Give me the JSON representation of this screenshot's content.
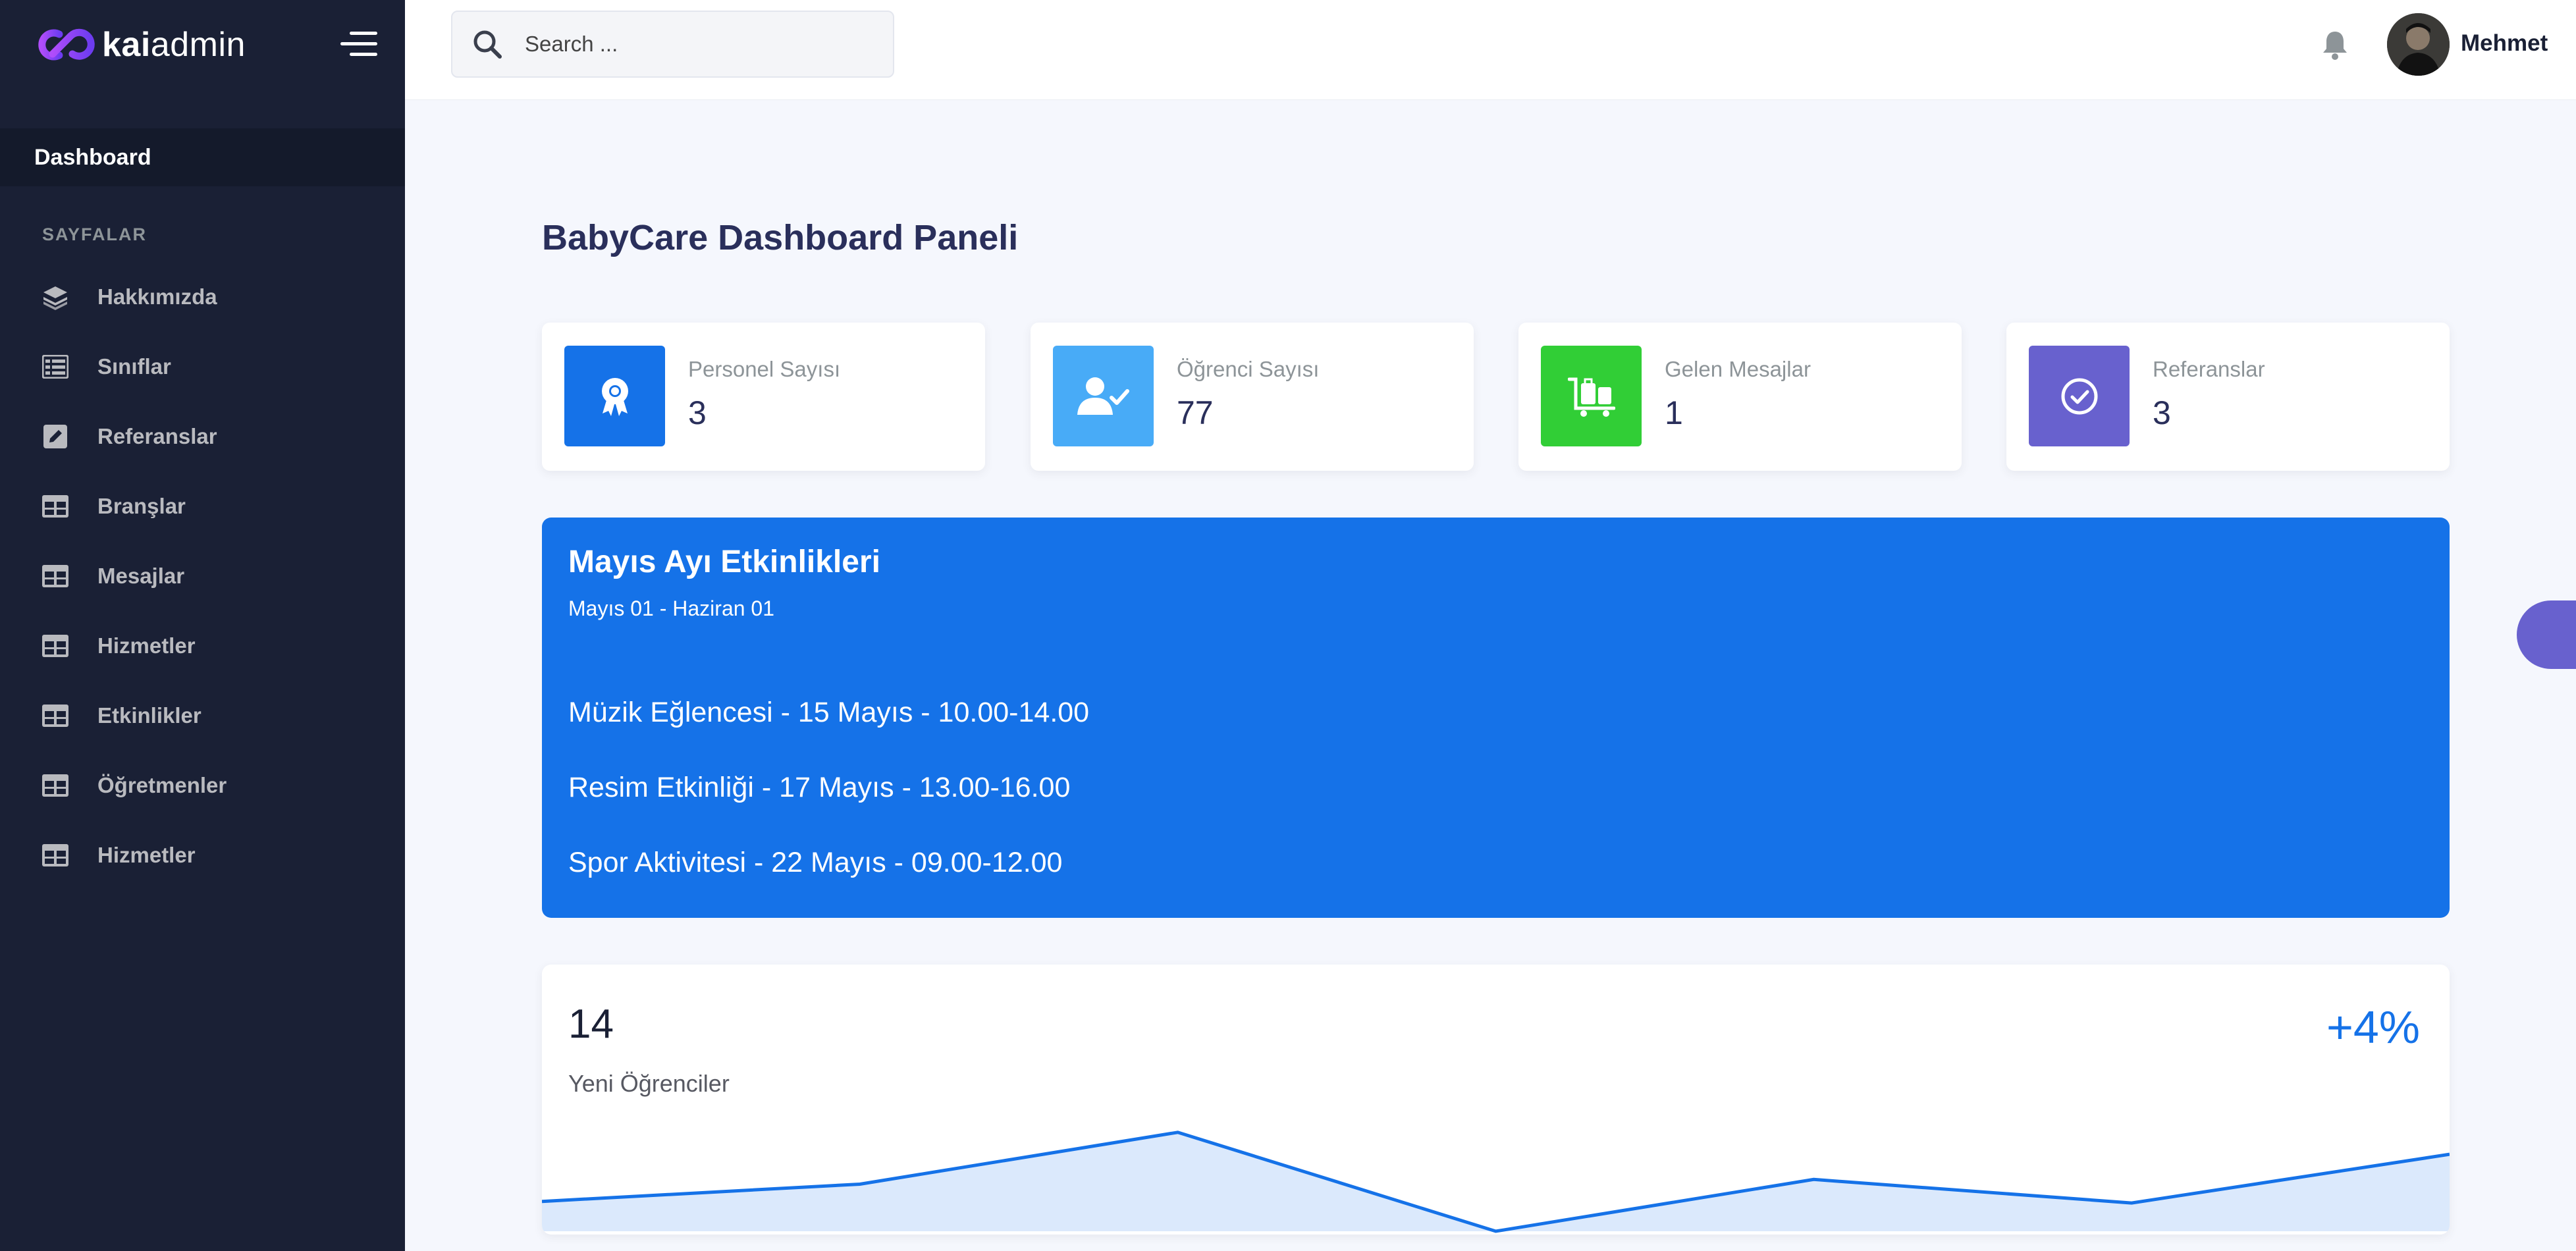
{
  "brand": {
    "name_bold": "kai",
    "name_light": "admin"
  },
  "sidebar": {
    "active_item": "Dashboard",
    "section_label": "SAYFALAR",
    "items": [
      {
        "label": "Hakkımızda",
        "icon": "layers-icon"
      },
      {
        "label": "Sınıflar",
        "icon": "table-list-icon"
      },
      {
        "label": "Referanslar",
        "icon": "pen-square-icon"
      },
      {
        "label": "Branşlar",
        "icon": "table-icon"
      },
      {
        "label": "Mesajlar",
        "icon": "table-icon"
      },
      {
        "label": "Hizmetler",
        "icon": "table-icon"
      },
      {
        "label": "Etkinlikler",
        "icon": "table-icon"
      },
      {
        "label": "Öğretmenler",
        "icon": "table-icon"
      },
      {
        "label": "Hizmetler",
        "icon": "table-icon"
      }
    ]
  },
  "header": {
    "search_placeholder": "Search ...",
    "username": "Mehmet"
  },
  "main": {
    "page_title": "BabyCare Dashboard Paneli",
    "cards": [
      {
        "label": "Personel Sayısı",
        "value": "3",
        "color": "#1572e8",
        "icon": "award-icon"
      },
      {
        "label": "Öğrenci Sayısı",
        "value": "77",
        "color": "#48abf7",
        "icon": "user-check-icon"
      },
      {
        "label": "Gelen Mesajlar",
        "value": "1",
        "color": "#31ce36",
        "icon": "luggage-cart-icon"
      },
      {
        "label": "Referanslar",
        "value": "3",
        "color": "#6861ce",
        "icon": "check-circle-icon"
      }
    ],
    "events": {
      "title": "Mayıs Ayı Etkinlikleri",
      "range": "Mayıs 01 - Haziran 01",
      "items": [
        "Müzik Eğlencesi - 15 Mayıs - 10.00-14.00",
        "Resim Etkinliği - 17 Mayıs - 13.00-16.00",
        "Spor Aktivitesi - 22 Mayıs - 09.00-12.00"
      ],
      "color": "#1572e8"
    },
    "stats": {
      "value": "14",
      "label": "Yeni Öğrenciler",
      "change": "+4%"
    }
  },
  "chart_data": {
    "type": "area",
    "x": [
      0,
      1,
      2,
      3,
      4,
      5,
      6
    ],
    "values": [
      19,
      30,
      63,
      0,
      33,
      18,
      49
    ],
    "ylim": [
      0,
      65
    ],
    "color": "#1572e8",
    "fill": "#dbe9fc"
  }
}
